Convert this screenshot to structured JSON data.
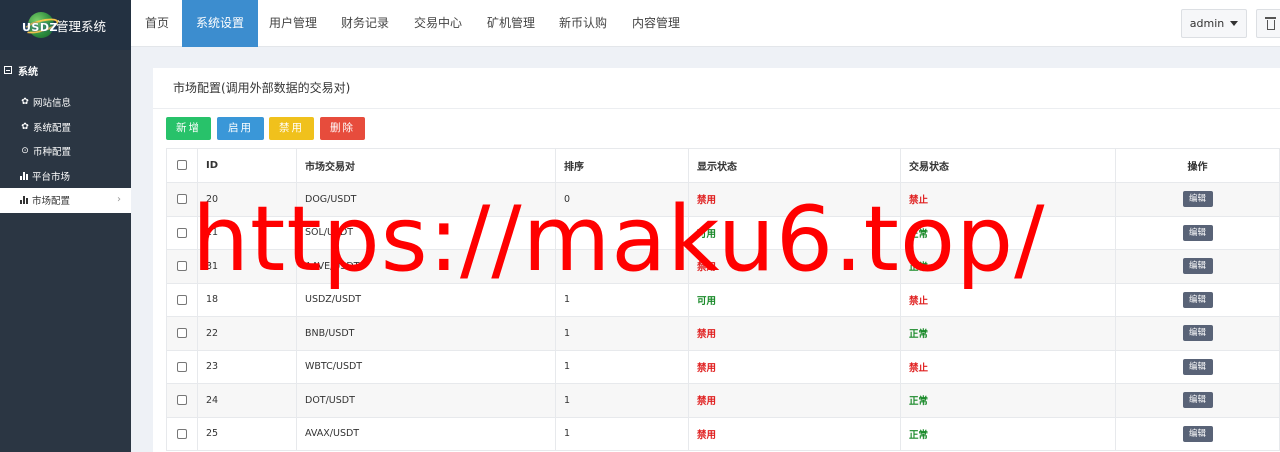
{
  "logo": {
    "mark_text": "USDZ",
    "title": "管理系统"
  },
  "sidebar": {
    "group": "系统",
    "items": [
      {
        "label": "网站信息",
        "icon": "gear-icon"
      },
      {
        "label": "系统配置",
        "icon": "gear-icon"
      },
      {
        "label": "币种配置",
        "icon": "circle-dot-icon"
      },
      {
        "label": "平台市场",
        "icon": "bar-chart-icon"
      },
      {
        "label": "市场配置",
        "icon": "bar-chart-icon",
        "active": true
      }
    ]
  },
  "topnav": {
    "tabs": [
      "首页",
      "系统设置",
      "用户管理",
      "财务记录",
      "交易中心",
      "矿机管理",
      "新币认购",
      "内容管理"
    ],
    "active_tab": "系统设置",
    "user": "admin"
  },
  "panel": {
    "title": "市场配置(调用外部数据的交易对)",
    "buttons": {
      "add": "新增",
      "enable": "启用",
      "disable": "禁用",
      "delete": "删除"
    }
  },
  "table": {
    "headers": {
      "id": "ID",
      "pair": "市场交易对",
      "sort": "排序",
      "show": "显示状态",
      "trade": "交易状态",
      "op": "操作"
    },
    "edit_label": "编辑",
    "rows": [
      {
        "id": "20",
        "pair": "DOG/USDT",
        "sort": "0",
        "show": "禁用",
        "trade": "禁止"
      },
      {
        "id": "21",
        "pair": "SOL/USDT",
        "sort": "0",
        "show": "可用",
        "trade": "正常"
      },
      {
        "id": "31",
        "pair": "AAVE/USDT",
        "sort": "1",
        "show": "禁用",
        "trade": "正常"
      },
      {
        "id": "18",
        "pair": "USDZ/USDT",
        "sort": "1",
        "show": "可用",
        "trade": "禁止"
      },
      {
        "id": "22",
        "pair": "BNB/USDT",
        "sort": "1",
        "show": "禁用",
        "trade": "正常"
      },
      {
        "id": "23",
        "pair": "WBTC/USDT",
        "sort": "1",
        "show": "禁用",
        "trade": "禁止"
      },
      {
        "id": "24",
        "pair": "DOT/USDT",
        "sort": "1",
        "show": "禁用",
        "trade": "正常"
      },
      {
        "id": "25",
        "pair": "AVAX/USDT",
        "sort": "1",
        "show": "禁用",
        "trade": "正常"
      }
    ]
  },
  "watermark": "https://maku6.top/",
  "colors": {
    "sidebar": "#2b3643",
    "active_tab": "#3c8dcf",
    "red": "#e02020",
    "green": "#1a8a2a",
    "watermark": "#ff0000"
  }
}
